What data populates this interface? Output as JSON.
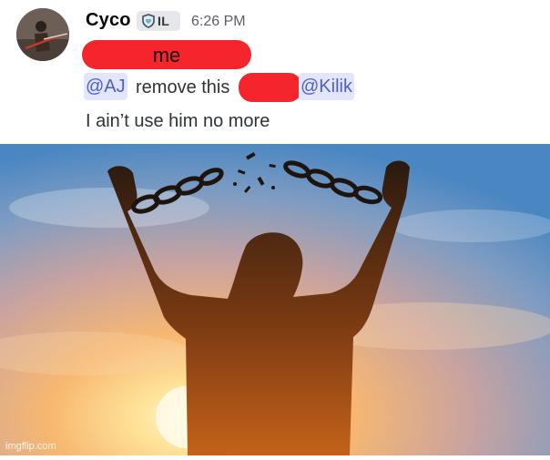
{
  "message": {
    "username": "Cyco",
    "tag": {
      "icon": "heart-shield-icon",
      "text": "IL"
    },
    "timestamp": "6:26 PM",
    "redacted_label": "me",
    "line2": {
      "mention_1": "@AJ",
      "text": "remove this",
      "mention_2": "@Kilik"
    },
    "line3": "I ain’t use him no more"
  },
  "image": {
    "description_icon": "broken-chains-silhouette",
    "watermark": "imgflip.com"
  },
  "colors": {
    "redaction": "#f5262b",
    "mention_text": "#4e5fc7",
    "mention_bg": "#e3e6fb",
    "sky_top": "#4a86c2",
    "sun": "#fff3c2"
  }
}
